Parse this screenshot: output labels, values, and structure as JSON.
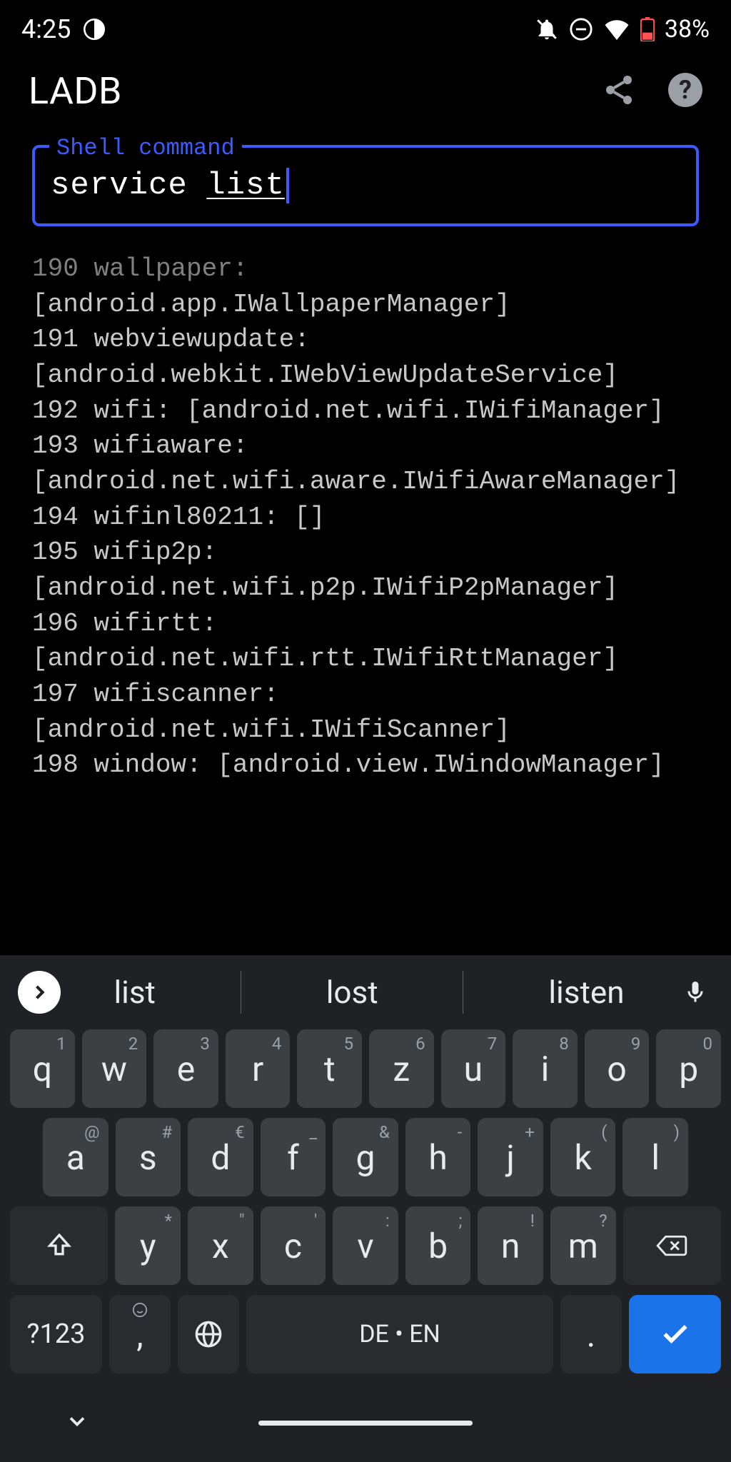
{
  "statusbar": {
    "time": "4:25",
    "battery_pct": "38%"
  },
  "appbar": {
    "title": "LADB"
  },
  "command": {
    "label": "Shell command",
    "value": "service list",
    "word1": "service",
    "word2": "list"
  },
  "terminal": {
    "cut_line": "190 wallpaper:",
    "lines": [
      "[android.app.IWallpaperManager]",
      "191 webviewupdate:",
      "[android.webkit.IWebViewUpdateService]",
      "192 wifi: [android.net.wifi.IWifiManager]",
      "193 wifiaware:",
      "[android.net.wifi.aware.IWifiAwareManager]",
      "194 wifinl80211: []",
      "195 wifip2p:",
      "[android.net.wifi.p2p.IWifiP2pManager]",
      "196 wifirtt:",
      "[android.net.wifi.rtt.IWifiRttManager]",
      "197 wifiscanner:",
      "[android.net.wifi.IWifiScanner]",
      "198 window: [android.view.IWindowManager]"
    ]
  },
  "keyboard": {
    "suggestions": [
      "list",
      "lost",
      "listen"
    ],
    "row1": [
      {
        "main": "q",
        "alt": "1"
      },
      {
        "main": "w",
        "alt": "2"
      },
      {
        "main": "e",
        "alt": "3"
      },
      {
        "main": "r",
        "alt": "4"
      },
      {
        "main": "t",
        "alt": "5"
      },
      {
        "main": "z",
        "alt": "6"
      },
      {
        "main": "u",
        "alt": "7"
      },
      {
        "main": "i",
        "alt": "8"
      },
      {
        "main": "o",
        "alt": "9"
      },
      {
        "main": "p",
        "alt": "0"
      }
    ],
    "row2": [
      {
        "main": "a",
        "alt": "@"
      },
      {
        "main": "s",
        "alt": "#"
      },
      {
        "main": "d",
        "alt": "€"
      },
      {
        "main": "f",
        "alt": "_"
      },
      {
        "main": "g",
        "alt": "&"
      },
      {
        "main": "h",
        "alt": "-"
      },
      {
        "main": "j",
        "alt": "+"
      },
      {
        "main": "k",
        "alt": "("
      },
      {
        "main": "l",
        "alt": ")"
      }
    ],
    "row3": [
      {
        "main": "y",
        "alt": "*"
      },
      {
        "main": "x",
        "alt": "\""
      },
      {
        "main": "c",
        "alt": "'"
      },
      {
        "main": "v",
        "alt": ":"
      },
      {
        "main": "b",
        "alt": ";"
      },
      {
        "main": "n",
        "alt": "!"
      },
      {
        "main": "m",
        "alt": "?"
      }
    ],
    "symkey": "?123",
    "comma": ",",
    "space": "DE • EN",
    "period": "."
  }
}
